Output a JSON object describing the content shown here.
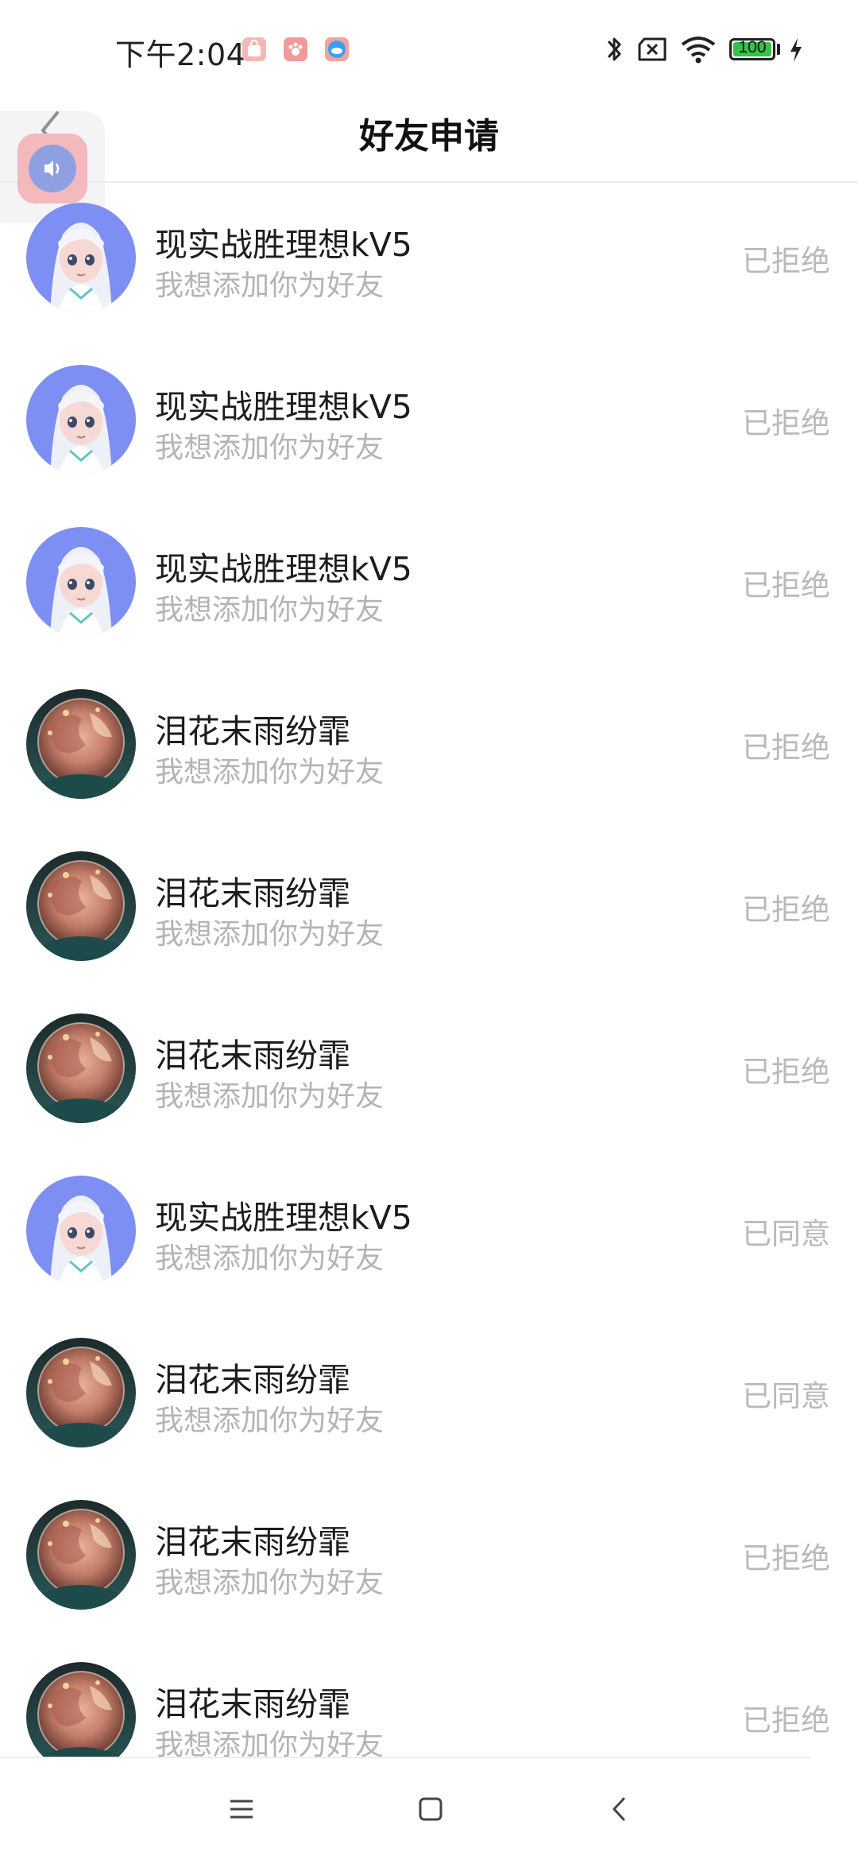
{
  "status_bar": {
    "time": "下午2:04",
    "battery": "100",
    "icons": [
      "bluetooth-icon",
      "sim-off-icon",
      "wifi-icon",
      "battery-icon",
      "charging-icon"
    ]
  },
  "header": {
    "title": "好友申请",
    "back_icon": "chevron-left-icon"
  },
  "requests": [
    {
      "avatar": "anime-girl-avatar",
      "name": "现实战胜理想kV5",
      "message": "我想添加你为好友",
      "status": "已拒绝"
    },
    {
      "avatar": "anime-girl-avatar",
      "name": "现实战胜理想kV5",
      "message": "我想添加你为好友",
      "status": "已拒绝"
    },
    {
      "avatar": "anime-girl-avatar",
      "name": "现实战胜理想kV5",
      "message": "我想添加你为好友",
      "status": "已拒绝"
    },
    {
      "avatar": "planet-avatar",
      "name": "泪花末雨纷霏",
      "message": "我想添加你为好友",
      "status": "已拒绝"
    },
    {
      "avatar": "planet-avatar",
      "name": "泪花末雨纷霏",
      "message": "我想添加你为好友",
      "status": "已拒绝"
    },
    {
      "avatar": "planet-avatar",
      "name": "泪花末雨纷霏",
      "message": "我想添加你为好友",
      "status": "已拒绝"
    },
    {
      "avatar": "anime-girl-avatar",
      "name": "现实战胜理想kV5",
      "message": "我想添加你为好友",
      "status": "已同意"
    },
    {
      "avatar": "planet-avatar",
      "name": "泪花末雨纷霏",
      "message": "我想添加你为好友",
      "status": "已同意"
    },
    {
      "avatar": "planet-avatar",
      "name": "泪花末雨纷霏",
      "message": "我想添加你为好友",
      "status": "已拒绝"
    },
    {
      "avatar": "planet-avatar",
      "name": "泪花末雨纷霏",
      "message": "我想添加你为好友",
      "status": "已拒绝"
    }
  ],
  "nav_bar": {
    "buttons": [
      "menu-icon",
      "home-square-icon",
      "back-chevron-icon"
    ]
  },
  "colors": {
    "title": "#111111",
    "name": "#1d1d1d",
    "message": "#b4b4b4",
    "status": "#b9b9b9",
    "divider": "#eeeeee"
  }
}
